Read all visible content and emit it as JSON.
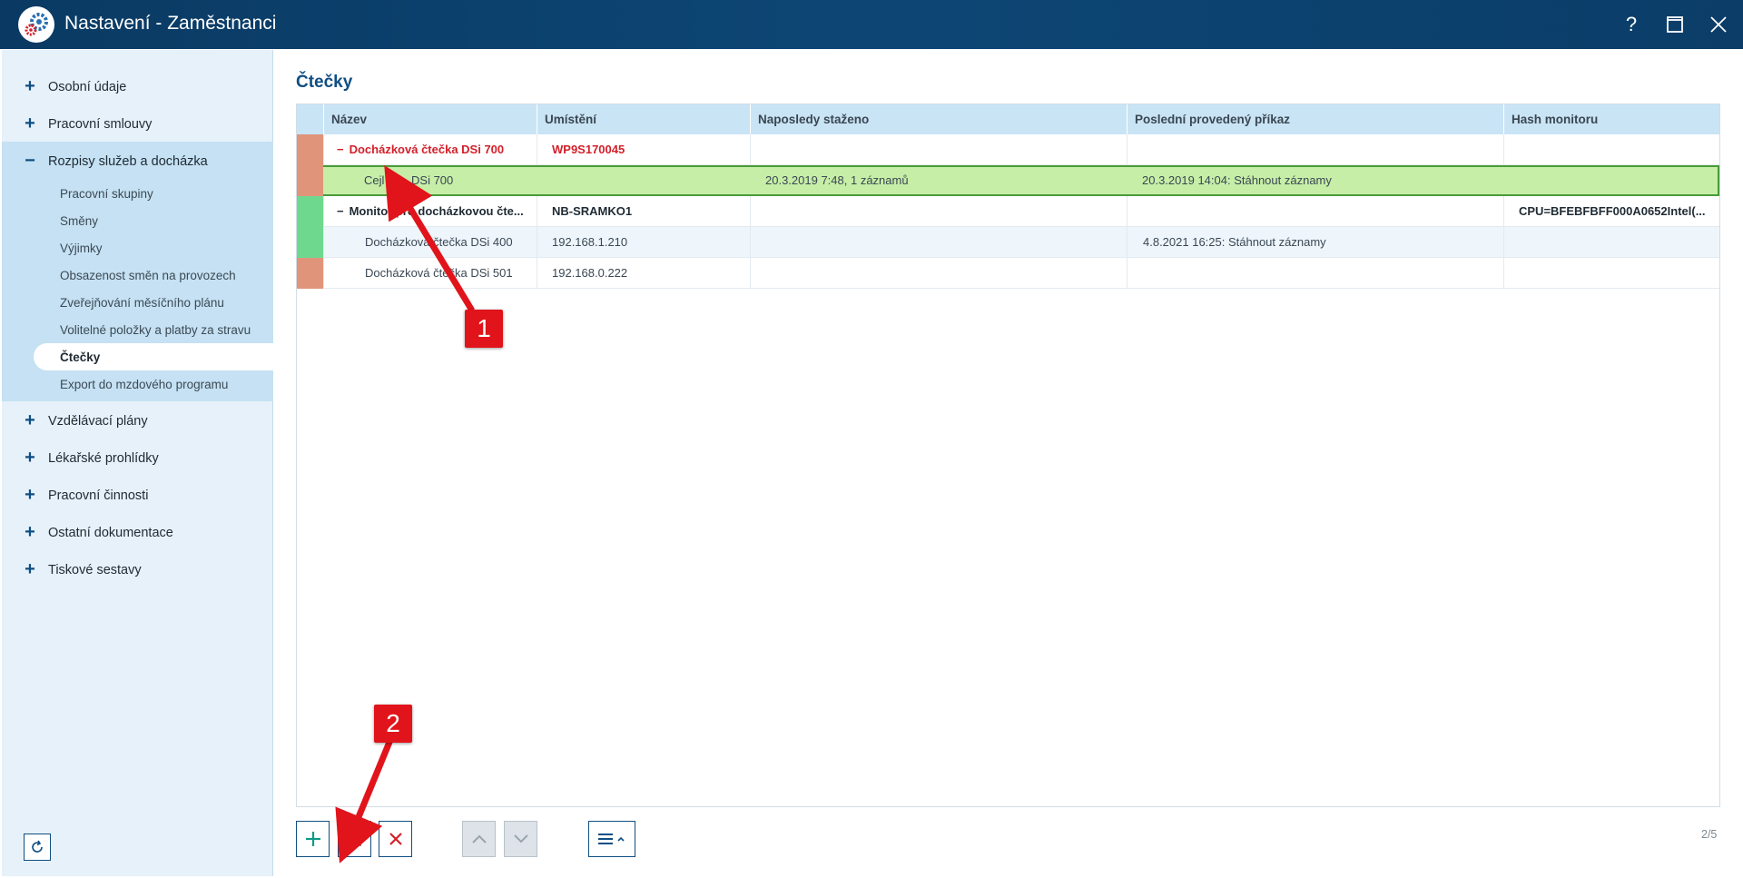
{
  "window": {
    "title": "Nastavení - Zaměstnanci",
    "help_label": "?",
    "maximize_icon": "maximize-icon",
    "close_icon": "close-icon"
  },
  "sidebar": {
    "groups_top": [
      {
        "sign": "+",
        "label": "Osobní údaje"
      },
      {
        "sign": "+",
        "label": "Pracovní smlouvy"
      },
      {
        "sign": "−",
        "label": "Rozpisy služeb a docházka"
      }
    ],
    "sub_items": [
      {
        "label": "Pracovní skupiny"
      },
      {
        "label": "Směny"
      },
      {
        "label": "Výjimky"
      },
      {
        "label": "Obsazenost směn na provozech"
      },
      {
        "label": "Zveřejňování měsíčního plánu"
      },
      {
        "label": "Volitelné položky a platby za stravu"
      },
      {
        "label": "Čtečky"
      },
      {
        "label": "Export do mzdového programu"
      }
    ],
    "groups_bottom": [
      {
        "sign": "+",
        "label": "Vzdělávací plány"
      },
      {
        "sign": "+",
        "label": "Lékařské prohlídky"
      },
      {
        "sign": "+",
        "label": "Pracovní činnosti"
      },
      {
        "sign": "+",
        "label": "Ostatní dokumentace"
      },
      {
        "sign": "+",
        "label": "Tiskové sestavy"
      }
    ],
    "active": "Čtečky"
  },
  "main": {
    "title": "Čtečky",
    "columns": [
      "Název",
      "Umístění",
      "Naposledy staženo",
      "Poslední provedený příkaz",
      "Hash monitoru"
    ],
    "rows": [
      {
        "marker": "#e0957b",
        "collapse": "−",
        "name": "Docházková čtečka DSi 700",
        "location": "WP9S170045",
        "last_download": "",
        "last_command": "",
        "hash": ""
      },
      {
        "marker": "#e0957b",
        "collapse": "",
        "name": "Cejl 62 - DSi 700",
        "location": "",
        "last_download": "20.3.2019 7:48, 1 záznamů",
        "last_command": "20.3.2019 14:04: Stáhnout záznamy",
        "hash": ""
      },
      {
        "marker": "#6fd88f",
        "collapse": "−",
        "name": "Monitor pro docházkovou čte...",
        "location": "NB-SRAMKO1",
        "last_download": "",
        "last_command": "",
        "hash": "CPU=BFEBFBFF000A0652Intel(..."
      },
      {
        "marker": "#6fd88f",
        "collapse": "",
        "name": "Docházková čtečka DSi 400",
        "location": "192.168.1.210",
        "last_download": "",
        "last_command": "4.8.2021 16:25: Stáhnout záznamy",
        "hash": ""
      },
      {
        "marker": "#e0957b",
        "collapse": "",
        "name": "Docházková čtečka DSi 501",
        "location": "192.168.0.222",
        "last_download": "",
        "last_command": "",
        "hash": ""
      }
    ],
    "page_counter": "2/5"
  },
  "toolbar": {
    "add_icon": "plus-icon",
    "edit_icon": "pencil-icon",
    "delete_icon": "delete-x-icon",
    "up_icon": "chevron-up-icon",
    "down_icon": "chevron-down-icon",
    "menu_icon": "menu-icon"
  },
  "annotations": [
    {
      "label": "1"
    },
    {
      "label": "2"
    }
  ],
  "colors": {
    "accent": "#0f4e82",
    "title_bar": "#0d4675",
    "sidebar_bg": "#e6f1fa",
    "sidebar_expanded": "#c5e1f3",
    "selected_row": "#c6eea7",
    "annotation": "#e1141b"
  }
}
